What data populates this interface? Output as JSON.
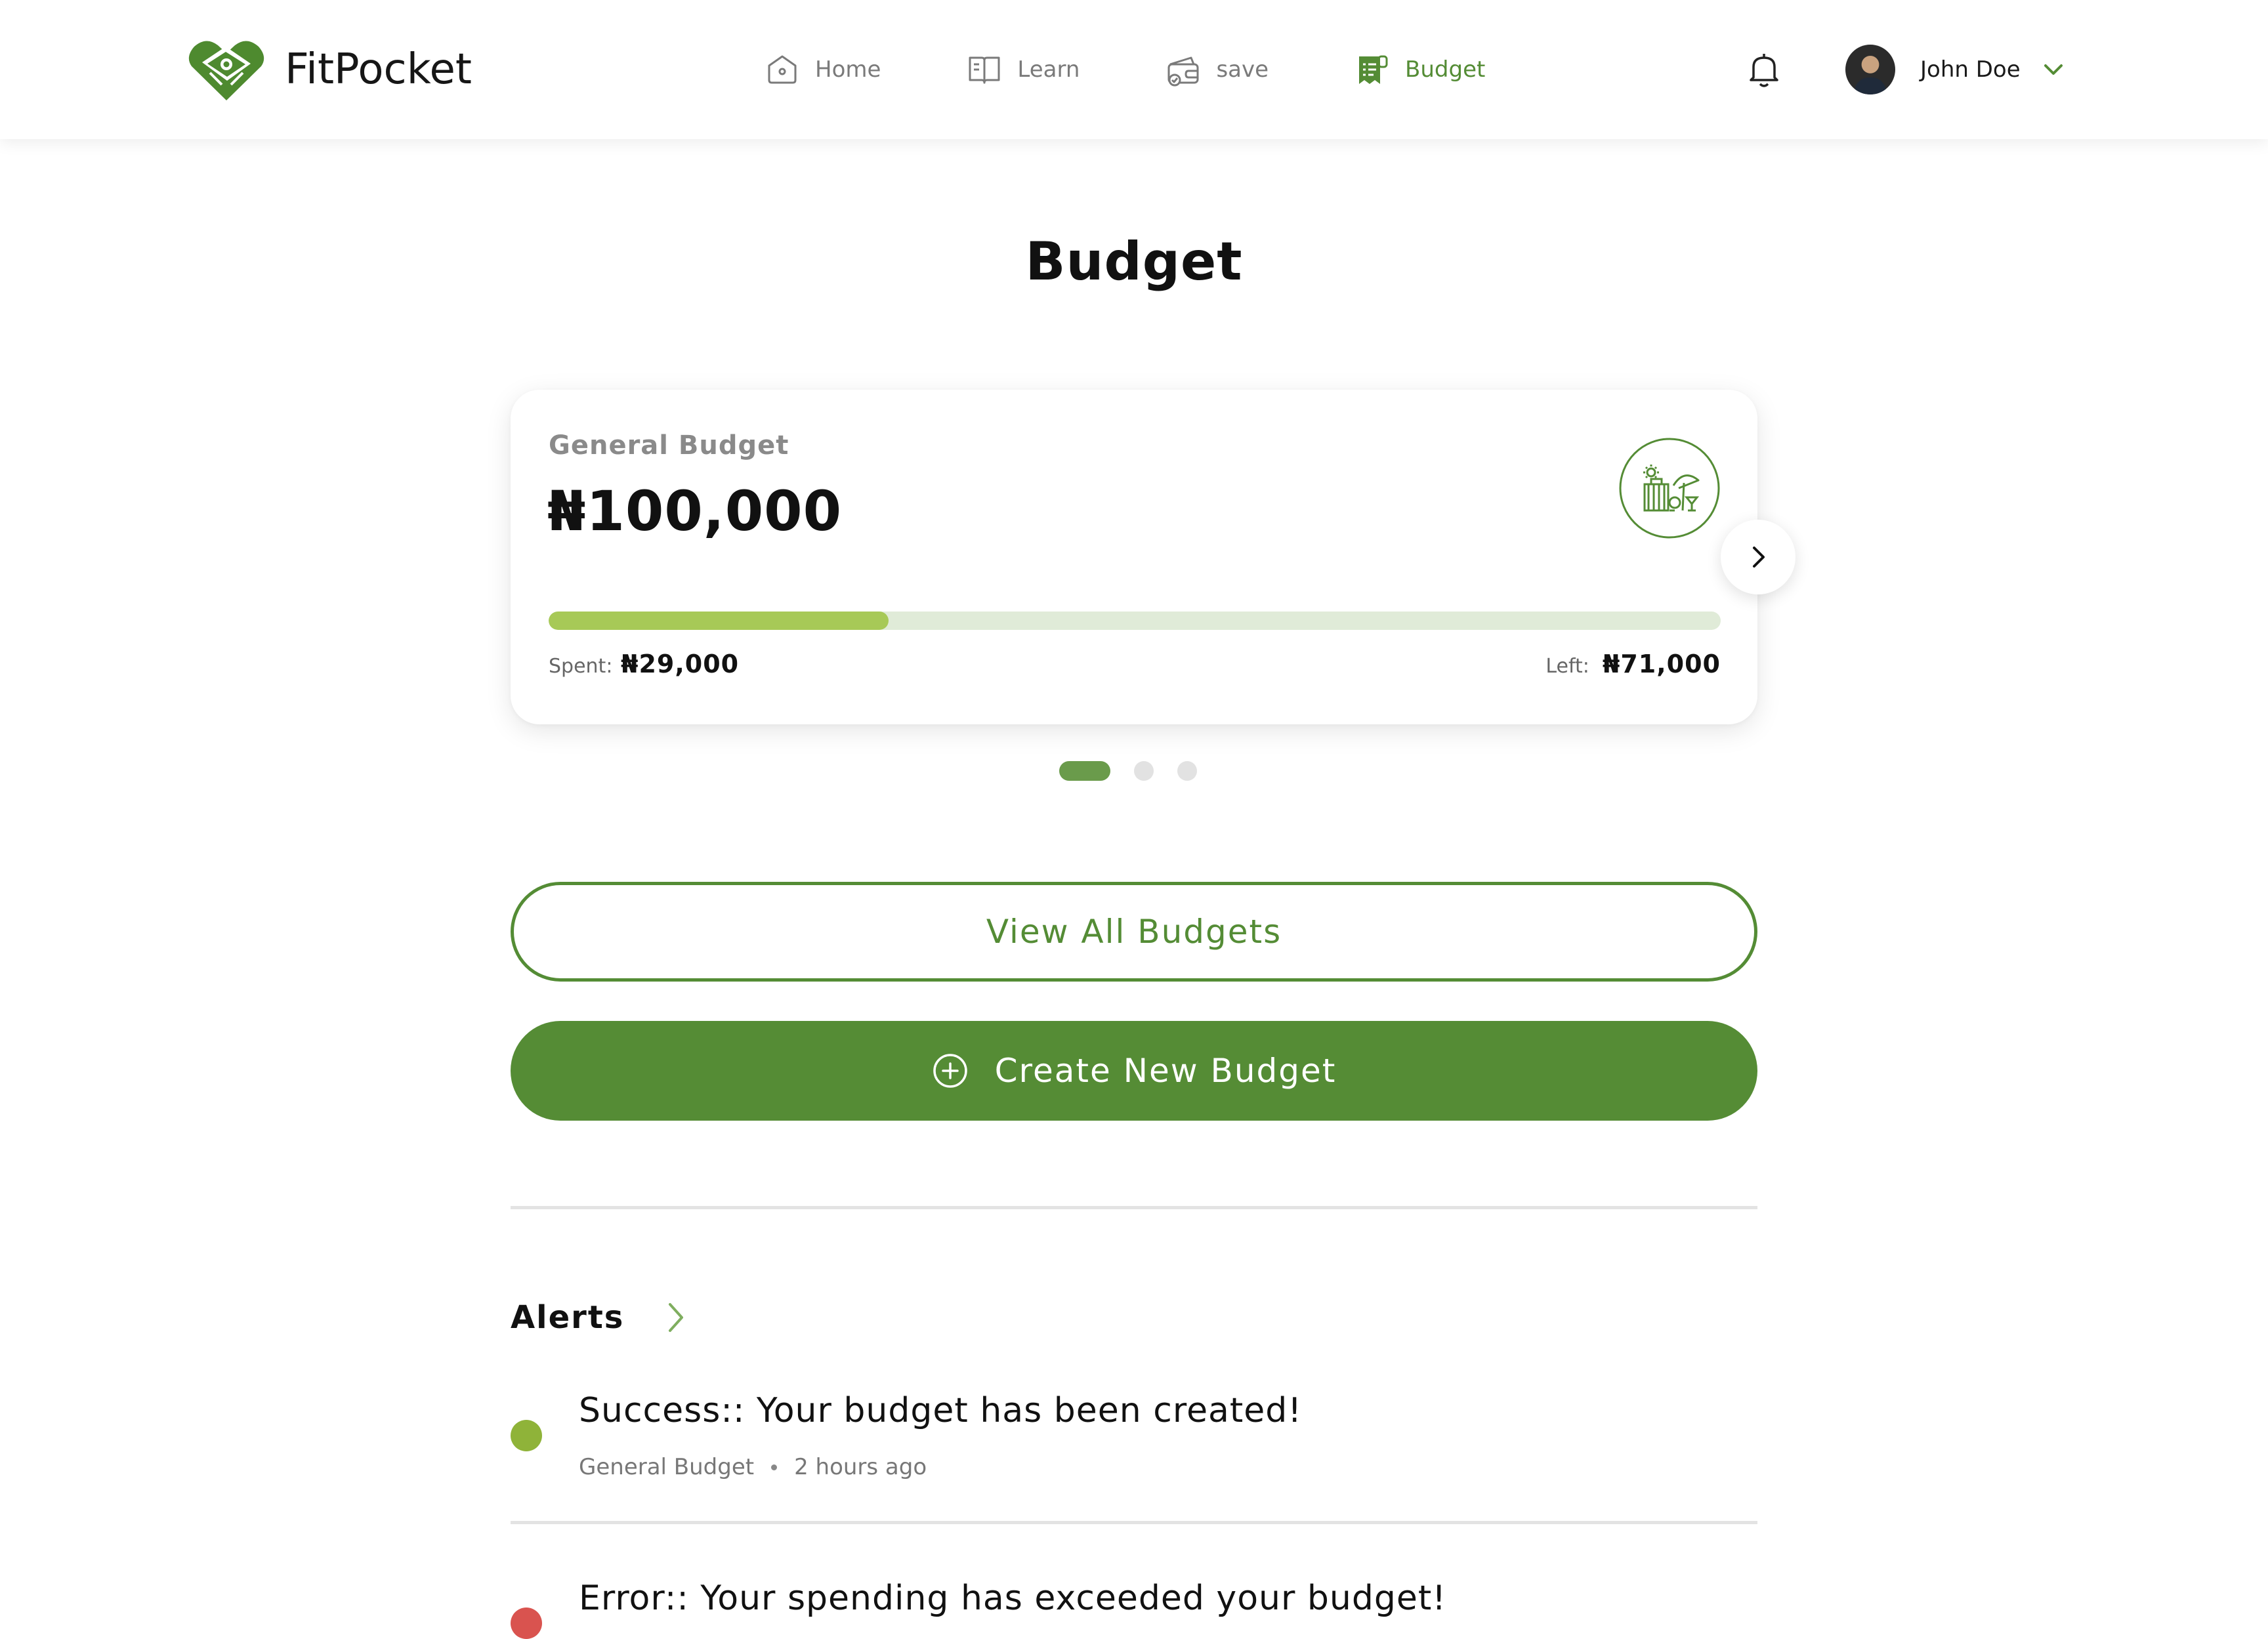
{
  "app": {
    "name": "FitPocket"
  },
  "nav": {
    "items": [
      {
        "label": "Home",
        "icon": "home-icon",
        "active": false
      },
      {
        "label": "Learn",
        "icon": "book-icon",
        "active": false
      },
      {
        "label": "save",
        "icon": "wallet-icon",
        "active": false
      },
      {
        "label": "Budget",
        "icon": "receipt-icon",
        "active": true
      }
    ]
  },
  "user": {
    "name": "John Doe"
  },
  "page": {
    "title": "Budget"
  },
  "budget_card": {
    "label": "General Budget",
    "amount": "₦100,000",
    "spent_label": "Spent:",
    "spent_value": "₦29,000",
    "left_label": "Left:",
    "left_value": "₦71,000",
    "progress_fraction": 0.29,
    "icon": "vacation-icon"
  },
  "carousel": {
    "count": 3,
    "active_index": 0
  },
  "actions": {
    "view_all": "View All Budgets",
    "create_new": "Create New Budget"
  },
  "alerts": {
    "title": "Alerts",
    "items": [
      {
        "message": "Success:: Your budget has been created!",
        "budget": "General Budget",
        "time": "2 hours ago",
        "status": "success",
        "color": "#8fb339"
      },
      {
        "message": "Error:: Your spending has exceeded your budget!",
        "status": "error",
        "color": "#d9534f"
      }
    ]
  },
  "colors": {
    "brand": "#558c35",
    "progress_fill": "#a7c957",
    "progress_track": "#e0ebd8",
    "nav_active": "#548c35"
  }
}
